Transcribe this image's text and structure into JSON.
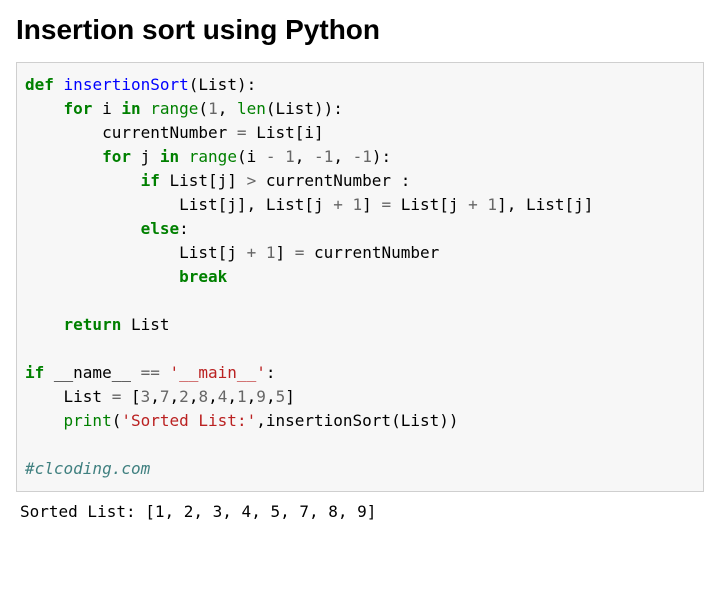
{
  "title": "Insertion sort using Python",
  "code": {
    "line1": {
      "def": "def",
      "name": "insertionSort",
      "params": "(List):"
    },
    "line2": {
      "kw_for": "for",
      "var_i": " i ",
      "kw_in": "in",
      "sp": " ",
      "range": "range",
      "lp": "(",
      "one": "1",
      "comma_sp": ", ",
      "len": "len",
      "rest": "(List)):"
    },
    "line3": {
      "lhs": "        currentNumber ",
      "eq": "=",
      "rhs": " List[i]"
    },
    "line4": {
      "kw_for": "for",
      "var_j": " j ",
      "kw_in": "in",
      "sp": " ",
      "range": "range",
      "lp": "(i ",
      "minus": "-",
      "sp2": " ",
      "one": "1",
      "comma_sp": ", ",
      "neg": "-",
      "one2": "1",
      "comma_sp2": ", ",
      "neg2": "-",
      "one3": "1",
      "rp": "):"
    },
    "line5": {
      "kw_if": "if",
      "cond1": " List[j] ",
      "gt": ">",
      "cond2": " currentNumber :"
    },
    "line6": {
      "pre": "                List[j], List[j ",
      "plus": "+",
      "sp": " ",
      "one": "1",
      "mid": "] ",
      "eq": "=",
      "post1": " List[j ",
      "plus2": "+",
      "sp2": " ",
      "one2": "1",
      "post2": "], List[j]"
    },
    "line7": {
      "kw_else": "else",
      "colon": ":"
    },
    "line8": {
      "pre": "                List[j ",
      "plus": "+",
      "sp": " ",
      "one": "1",
      "post": "] ",
      "eq": "=",
      "rhs": " currentNumber"
    },
    "line9": {
      "kw_break": "break"
    },
    "line10": {
      "kw_return": "return",
      "rest": " List"
    },
    "line11": {
      "kw_if": "if",
      "name": " __name__ ",
      "eqeq": "==",
      "sp": " ",
      "str": "'__main__'",
      "colon": ":"
    },
    "line12": {
      "pre": "    List ",
      "eq": "=",
      "sp": " [",
      "n1": "3",
      "c": ",",
      "n2": "7",
      "n3": "2",
      "n4": "8",
      "n5": "4",
      "n6": "1",
      "n7": "9",
      "n8": "5",
      "close": "]"
    },
    "line13": {
      "print": "print",
      "lp": "(",
      "str": "'Sorted List:'",
      "rest": ",insertionSort(List))"
    },
    "comment": "#clcoding.com"
  },
  "output": "Sorted List: [1, 2, 3, 4, 5, 7, 8, 9]"
}
